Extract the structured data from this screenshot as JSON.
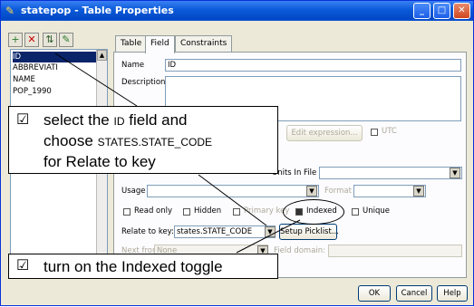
{
  "window": {
    "title": "statepop - Table Properties",
    "icon": "app-icon",
    "controls": [
      "_",
      "□",
      "✕"
    ]
  },
  "toolbar": {
    "icons": [
      "add-field-icon",
      "delete-field-icon",
      "move-field-icon",
      "edit-field-icon"
    ]
  },
  "field_list": {
    "items": [
      "ID",
      "ABBREVIATI",
      "NAME",
      "POP_1990"
    ],
    "selected": "ID"
  },
  "tabs": [
    "Table",
    "Field",
    "Constraints"
  ],
  "active_tab": "Field",
  "form": {
    "name_label": "Name",
    "name_value": "ID",
    "description_label": "Description",
    "edit_expression_button": "Edit expression...",
    "utc_label": "UTC",
    "units_in_file_label": "Units In File",
    "usage_label": "Usage",
    "format_label": "Format",
    "read_only_label": "Read only",
    "hidden_label": "Hidden",
    "primary_key_label": "Primary key",
    "indexed_label": "Indexed",
    "unique_label": "Unique",
    "relate_to_key_label": "Relate to key:",
    "relate_to_key_value": "states.STATE_CODE",
    "setup_picklist_button": "Setup Picklist...",
    "next_from_label": "Next from:",
    "next_from_value": "None",
    "field_domain_label": "Field domain:"
  },
  "buttons": {
    "ok": "OK",
    "cancel": "Cancel",
    "help": "Help"
  },
  "callouts": {
    "checkbox": "☑",
    "select_line1": "select the",
    "select_id": "ID",
    "select_line1b": "field and",
    "select_line2": "choose",
    "select_key": "STATES.STATE_CODE",
    "select_line3": "for Relate to key",
    "indexed_hint": "turn on the Indexed toggle"
  }
}
